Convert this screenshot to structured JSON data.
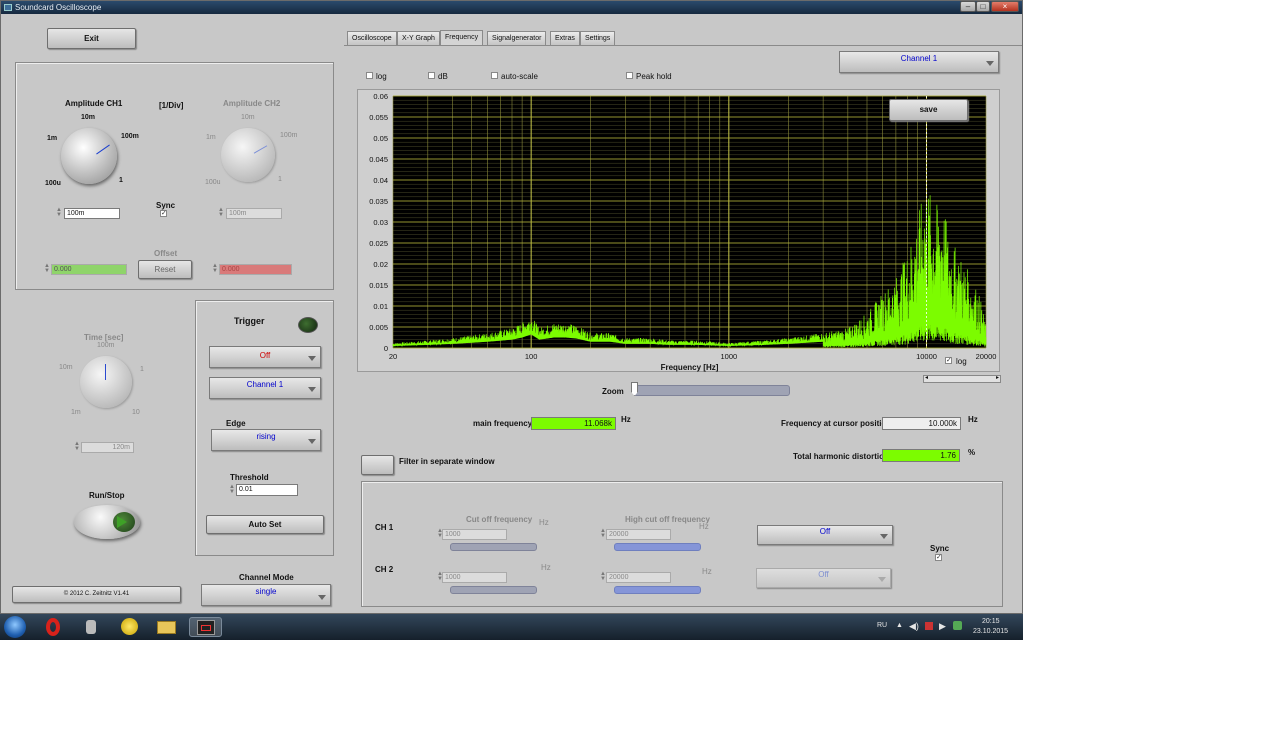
{
  "window": {
    "title": "Soundcard Oscilloscope"
  },
  "left": {
    "exit_label": "Exit",
    "amp1_title": "Amplitude CH1",
    "amp_unit": "[1/Div]",
    "amp2_title": "Amplitude CH2",
    "amp1_ticks": {
      "t10m": "10m",
      "t1m": "1m",
      "t100m": "100m",
      "t100u": "100u",
      "t1": "1"
    },
    "amp2_ticks": {
      "t10m": "10m",
      "t1m": "1m",
      "t100m": "100m",
      "t100u": "100u",
      "t1": "1"
    },
    "amp1_value": "100m",
    "amp2_value": "100m",
    "sync_label": "Sync",
    "offset_label": "Offset",
    "offset1_value": "0.000",
    "offset2_value": "0.000",
    "reset_label": "Reset",
    "time_title": "Time [sec]",
    "time_ticks": {
      "t100m": "100m",
      "t10m": "10m",
      "t1": "1",
      "t1m": "1m",
      "t10": "10"
    },
    "time_value": "120m",
    "runstop_label": "Run/Stop",
    "copyright": "© 2012  C. Zeitnitz V1.41",
    "channel_mode_label": "Channel Mode",
    "channel_mode_value": "single"
  },
  "trigger": {
    "title": "Trigger",
    "mode": "Off",
    "channel": "Channel 1",
    "edge_label": "Edge",
    "edge_value": "rising",
    "threshold_label": "Threshold",
    "threshold_value": "0.01",
    "autoset_label": "Auto Set"
  },
  "tabs": [
    "Oscilloscope",
    "X-Y Graph",
    "Frequency",
    "Signalgenerator",
    "Extras",
    "Settings"
  ],
  "active_tab": "Frequency",
  "freq": {
    "channel_select": "Channel 1",
    "opt_log": "log",
    "opt_db": "dB",
    "opt_autoscale": "auto-scale",
    "opt_peakhold": "Peak hold",
    "save_label": "save",
    "xaxis_label": "Frequency [Hz]",
    "xlog_label": "log",
    "zoom_label": "Zoom",
    "main_freq_label": "main frequency",
    "main_freq_value": "11.068k",
    "hz_unit": "Hz",
    "cursor_freq_label": "Frequency at cursor position",
    "cursor_freq_value": "10.000k",
    "thd_label": "Total harmonic distortion",
    "thd_value": "1.76",
    "percent_unit": "%",
    "filter_window_label": "Filter in separate window"
  },
  "filter": {
    "ch1_label": "CH 1",
    "ch2_label": "CH 2",
    "cutoff_label": "Cut off frequency",
    "highcut_label": "High cut off frequency",
    "hz": "Hz",
    "ch1_cutoff": "1000",
    "ch1_highcut": "20000",
    "ch2_cutoff": "1000",
    "ch2_highcut": "20000",
    "ch1_mode": "Off",
    "ch2_mode": "Off",
    "sync_label": "Sync"
  },
  "taskbar": {
    "lang": "RU",
    "time": "20:15",
    "date": "23.10.2015"
  },
  "colors": {
    "spectrum": "#7cfc00",
    "plot_bg": "#000000",
    "grid": "#b8b83a",
    "accent_blue": "#0000cc",
    "trigger_red": "#cc0000"
  },
  "chart_data": {
    "type": "line",
    "xlabel": "Frequency [Hz]",
    "ylabel": "",
    "xscale": "log",
    "xlim": [
      20,
      20000
    ],
    "ylim": [
      0,
      0.06
    ],
    "xticks": [
      "20",
      "100",
      "1000",
      "10000",
      "20000"
    ],
    "yticks": [
      "0",
      "0.005",
      "0.01",
      "0.015",
      "0.02",
      "0.025",
      "0.03",
      "0.035",
      "0.04",
      "0.045",
      "0.05",
      "0.055",
      "0.06"
    ],
    "cursor_x": 10000,
    "x": [
      20,
      30,
      40,
      50,
      60,
      70,
      80,
      90,
      100,
      110,
      130,
      150,
      170,
      200,
      250,
      300,
      400,
      500,
      700,
      1000,
      1500,
      2000,
      3000,
      4000,
      5000,
      6000,
      7000,
      8000,
      9000,
      10000,
      11000,
      12000,
      13000,
      14000,
      15000,
      16000,
      17000,
      18000,
      19000,
      20000
    ],
    "y": [
      0.001,
      0.0015,
      0.002,
      0.0025,
      0.003,
      0.0035,
      0.004,
      0.005,
      0.0065,
      0.004,
      0.005,
      0.005,
      0.0045,
      0.003,
      0.003,
      0.002,
      0.002,
      0.0015,
      0.0015,
      0.001,
      0.0015,
      0.002,
      0.003,
      0.004,
      0.007,
      0.011,
      0.014,
      0.019,
      0.026,
      0.033,
      0.028,
      0.03,
      0.022,
      0.02,
      0.018,
      0.016,
      0.013,
      0.012,
      0.009,
      0.004
    ]
  }
}
